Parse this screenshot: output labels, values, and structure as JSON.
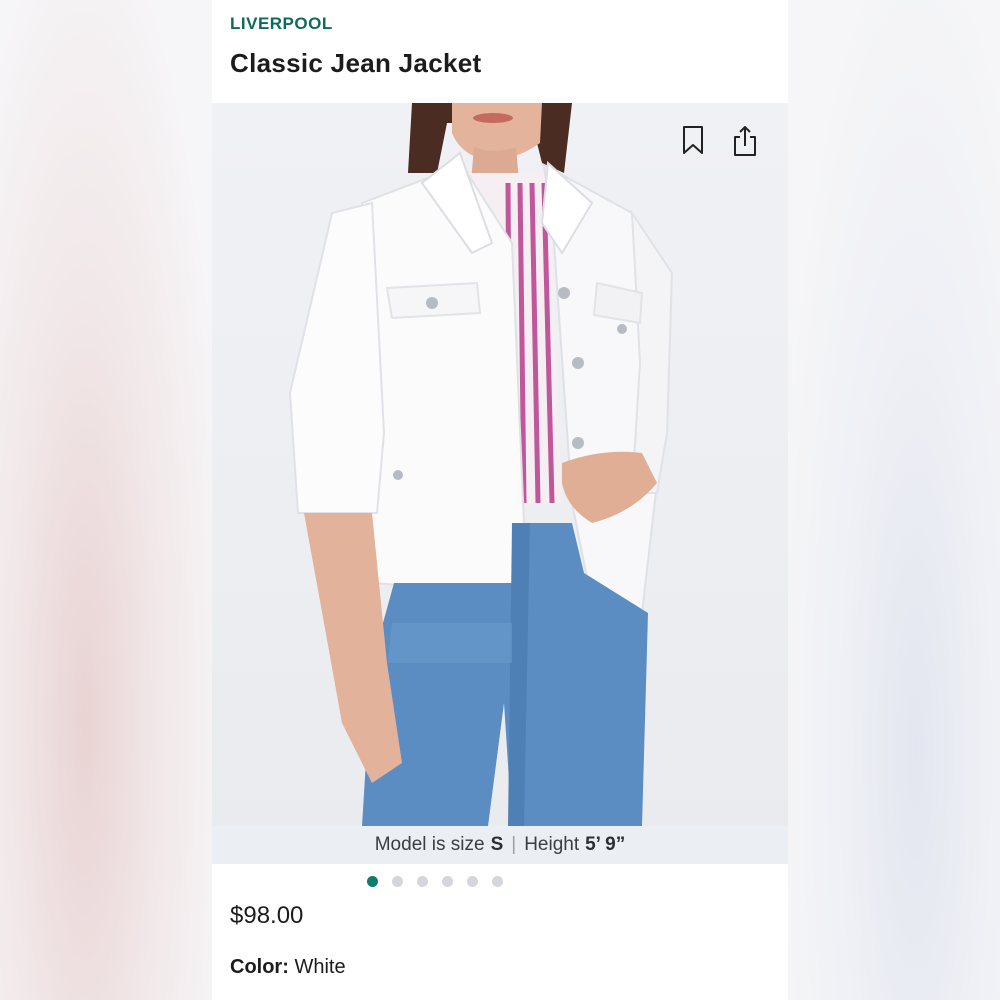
{
  "product": {
    "brand": "LIVERPOOL",
    "title": "Classic Jean Jacket",
    "price": "$98.00",
    "color_label": "Color:",
    "color_value": "White"
  },
  "gallery": {
    "image_subject": "model wearing white jean jacket",
    "model_size_text": "Model is size",
    "model_size_value": "S",
    "separator": "|",
    "height_text": "Height",
    "height_value": "5’ 9”",
    "total_images": 6,
    "active_index": 0
  },
  "icons": {
    "bookmark": "bookmark-icon",
    "share": "share-icon"
  },
  "colors": {
    "brand": "#0d6b5c",
    "active_dot": "#0f7c6d",
    "inactive_dot": "#d3d6db"
  }
}
